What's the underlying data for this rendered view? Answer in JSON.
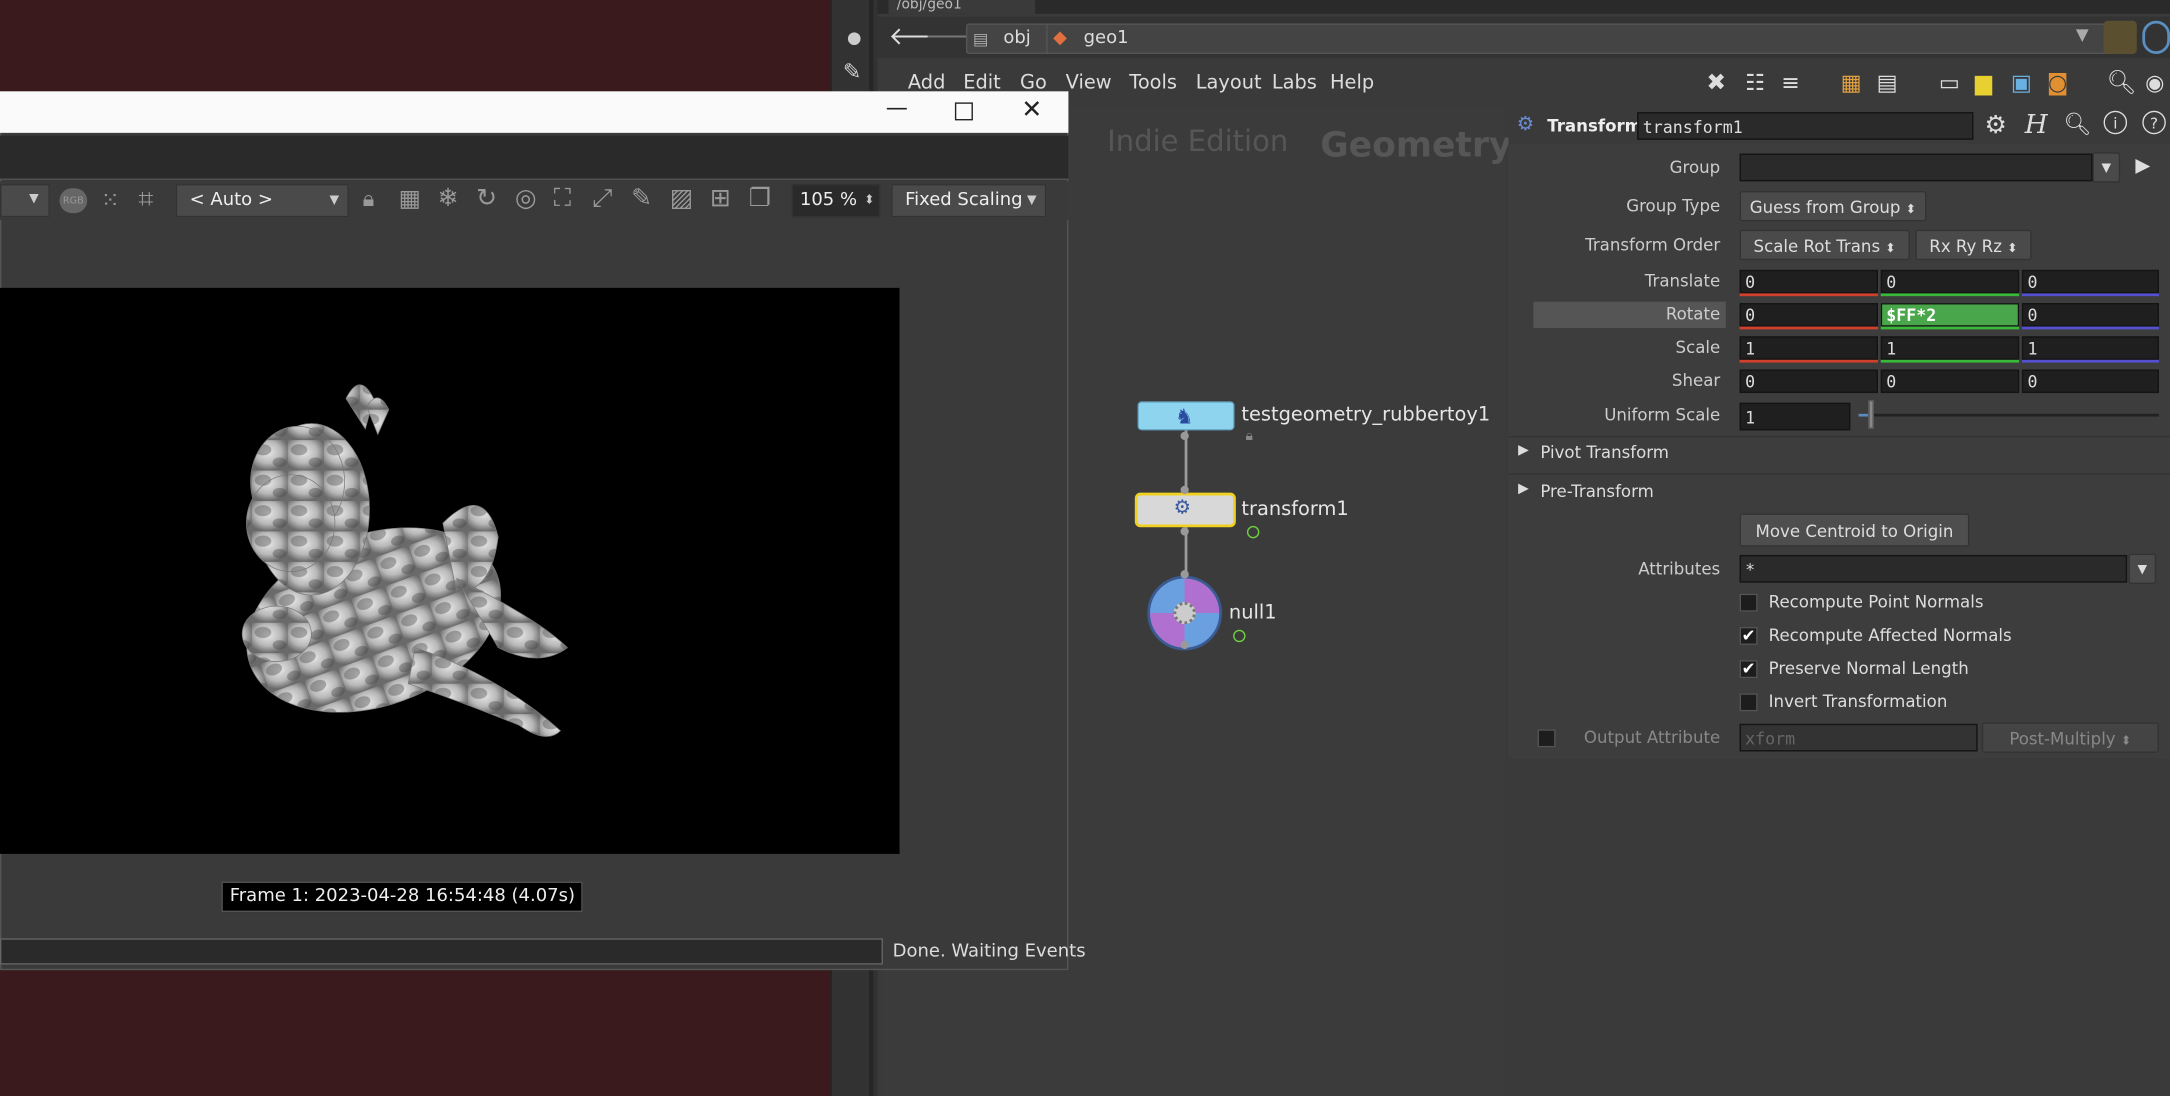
{
  "houdini": {
    "tab_title": "/obj/geo1",
    "path": [
      "obj",
      "geo1"
    ],
    "menu": [
      "Add",
      "Edit",
      "Go",
      "View",
      "Tools",
      "Layout",
      "Labs",
      "Help"
    ]
  },
  "network": {
    "edition": "Indie Edition",
    "context": "Geometry",
    "nodes": [
      {
        "name": "testgeometry_rubbertoy1",
        "color": "#8fd4ee"
      },
      {
        "name": "transform1",
        "color": "#d8d8d8",
        "selected": true
      },
      {
        "name": "null1",
        "color": "#5a8fd0"
      }
    ]
  },
  "params": {
    "node_type": "Transform",
    "node_name": "transform1",
    "labels": {
      "group": "Group",
      "group_type": "Group Type",
      "transform_order": "Transform Order",
      "translate": "Translate",
      "rotate": "Rotate",
      "scale": "Scale",
      "shear": "Shear",
      "uniform_scale": "Uniform Scale",
      "attributes": "Attributes",
      "output_attribute": "Output Attribute"
    },
    "group_value": "",
    "group_type": "Guess from Group",
    "transform_order": "Scale Rot Trans",
    "rotate_order": "Rx Ry Rz",
    "translate": [
      "0",
      "0",
      "0"
    ],
    "rotate": [
      "0",
      "$FF*2",
      "0"
    ],
    "scale": [
      "1",
      "1",
      "1"
    ],
    "shear": [
      "0",
      "0",
      "0"
    ],
    "uniform_scale": "1",
    "uniform_scale_slider": 0.03,
    "pivot_transform": "Pivot Transform",
    "pre_transform": "Pre-Transform",
    "move_centroid": "Move Centroid to Origin",
    "attributes": "*",
    "checkboxes": [
      {
        "label": "Recompute Point Normals",
        "checked": false
      },
      {
        "label": "Recompute Affected Normals",
        "checked": true
      },
      {
        "label": "Preserve Normal Length",
        "checked": true
      },
      {
        "label": "Invert Transformation",
        "checked": false
      }
    ],
    "output_attribute_placeholder": "xform",
    "output_mode": "Post-Multiply",
    "axis_colors": {
      "x": "#d0402c",
      "y": "#3ab83a",
      "z": "#5550d0"
    }
  },
  "mplay": {
    "lut": "< Auto >",
    "zoom": "105 %",
    "scaling": "Fixed Scaling",
    "rgb_label": "RGB",
    "frame_label": "Frame  1:  2023-04-28  16:54:48  (4.07s)",
    "status": "Done. Waiting Events"
  }
}
